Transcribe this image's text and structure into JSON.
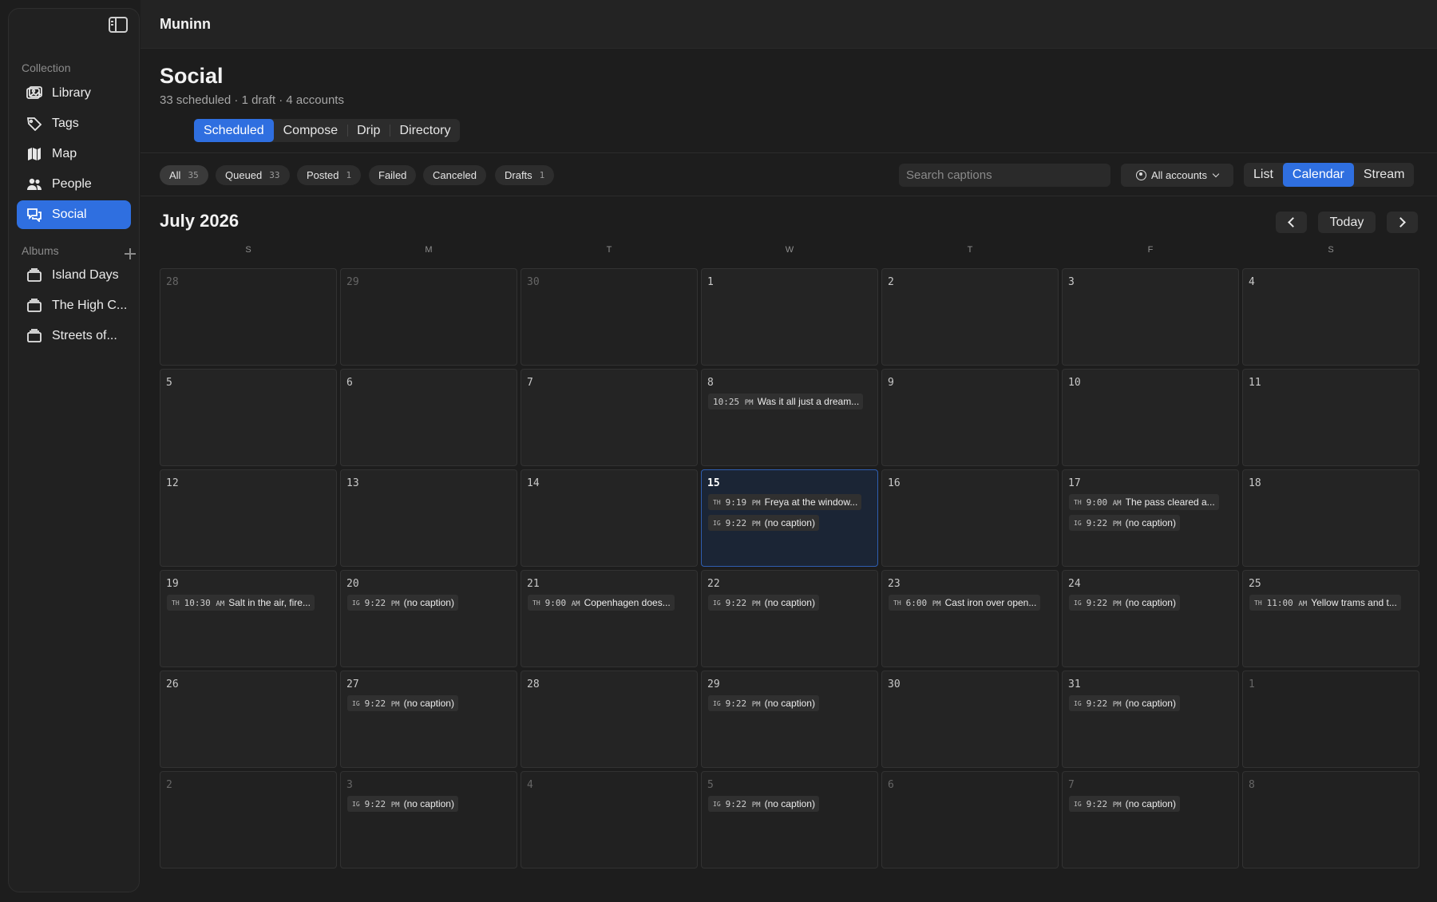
{
  "app": {
    "title": "Muninn"
  },
  "sidebar": {
    "collection_label": "Collection",
    "items": [
      {
        "label": "Library",
        "icon": "library-icon"
      },
      {
        "label": "Tags",
        "icon": "tag-icon"
      },
      {
        "label": "Map",
        "icon": "map-icon"
      },
      {
        "label": "People",
        "icon": "people-icon"
      },
      {
        "label": "Social",
        "icon": "social-icon",
        "active": true
      }
    ],
    "albums_label": "Albums",
    "albums": [
      {
        "label": "Island Days"
      },
      {
        "label": "The High C..."
      },
      {
        "label": "Streets of..."
      }
    ]
  },
  "page": {
    "title": "Social",
    "subtitle": "33 scheduled · 1 draft · 4 accounts",
    "tabs": [
      {
        "label": "Scheduled",
        "active": true
      },
      {
        "label": "Compose"
      },
      {
        "label": "Drip"
      },
      {
        "label": "Directory"
      }
    ]
  },
  "filters": [
    {
      "label": "All",
      "count": "35",
      "active": true
    },
    {
      "label": "Queued",
      "count": "33"
    },
    {
      "label": "Posted",
      "count": "1"
    },
    {
      "label": "Failed",
      "count": ""
    },
    {
      "label": "Canceled",
      "count": ""
    },
    {
      "label": "Drafts",
      "count": "1"
    }
  ],
  "search": {
    "placeholder": "Search captions"
  },
  "accounts": {
    "label": "All accounts"
  },
  "view_modes": [
    {
      "label": "List"
    },
    {
      "label": "Calendar",
      "active": true
    },
    {
      "label": "Stream"
    }
  ],
  "calendar": {
    "month_label": "July 2026",
    "today_label": "Today",
    "weekdays": [
      "S",
      "M",
      "T",
      "W",
      "T",
      "F",
      "S"
    ],
    "weeks": [
      [
        {
          "day": "28",
          "outside": true,
          "events": []
        },
        {
          "day": "29",
          "outside": true,
          "events": []
        },
        {
          "day": "30",
          "outside": true,
          "events": []
        },
        {
          "day": "1",
          "events": []
        },
        {
          "day": "2",
          "events": []
        },
        {
          "day": "3",
          "events": []
        },
        {
          "day": "4",
          "events": []
        }
      ],
      [
        {
          "day": "5",
          "events": []
        },
        {
          "day": "6",
          "events": []
        },
        {
          "day": "7",
          "events": []
        },
        {
          "day": "8",
          "events": [
            {
              "tag": "",
              "time": "10:25",
              "ampm": "PM",
              "caption": "Was it all just a dream..."
            }
          ]
        },
        {
          "day": "9",
          "events": []
        },
        {
          "day": "10",
          "events": []
        },
        {
          "day": "11",
          "events": []
        }
      ],
      [
        {
          "day": "12",
          "events": []
        },
        {
          "day": "13",
          "events": []
        },
        {
          "day": "14",
          "events": []
        },
        {
          "day": "15",
          "today": true,
          "events": [
            {
              "tag": "TH",
              "time": "9:19",
              "ampm": "PM",
              "caption": "Freya at the window..."
            },
            {
              "tag": "IG",
              "time": "9:22",
              "ampm": "PM",
              "caption": "(no caption)"
            }
          ]
        },
        {
          "day": "16",
          "events": []
        },
        {
          "day": "17",
          "events": [
            {
              "tag": "TH",
              "time": "9:00",
              "ampm": "AM",
              "caption": "The pass cleared a..."
            },
            {
              "tag": "IG",
              "time": "9:22",
              "ampm": "PM",
              "caption": "(no caption)"
            }
          ]
        },
        {
          "day": "18",
          "events": []
        }
      ],
      [
        {
          "day": "19",
          "events": [
            {
              "tag": "TH",
              "time": "10:30",
              "ampm": "AM",
              "caption": "Salt in the air, fire..."
            }
          ]
        },
        {
          "day": "20",
          "events": [
            {
              "tag": "IG",
              "time": "9:22",
              "ampm": "PM",
              "caption": "(no caption)"
            }
          ]
        },
        {
          "day": "21",
          "events": [
            {
              "tag": "TH",
              "time": "9:00",
              "ampm": "AM",
              "caption": "Copenhagen does..."
            }
          ]
        },
        {
          "day": "22",
          "events": [
            {
              "tag": "IG",
              "time": "9:22",
              "ampm": "PM",
              "caption": "(no caption)"
            }
          ]
        },
        {
          "day": "23",
          "events": [
            {
              "tag": "TH",
              "time": "6:00",
              "ampm": "PM",
              "caption": "Cast iron over open..."
            }
          ]
        },
        {
          "day": "24",
          "events": [
            {
              "tag": "IG",
              "time": "9:22",
              "ampm": "PM",
              "caption": "(no caption)"
            }
          ]
        },
        {
          "day": "25",
          "events": [
            {
              "tag": "TH",
              "time": "11:00",
              "ampm": "AM",
              "caption": "Yellow trams and t..."
            }
          ]
        }
      ],
      [
        {
          "day": "26",
          "events": []
        },
        {
          "day": "27",
          "events": [
            {
              "tag": "IG",
              "time": "9:22",
              "ampm": "PM",
              "caption": "(no caption)"
            }
          ]
        },
        {
          "day": "28",
          "events": []
        },
        {
          "day": "29",
          "events": [
            {
              "tag": "IG",
              "time": "9:22",
              "ampm": "PM",
              "caption": "(no caption)"
            }
          ]
        },
        {
          "day": "30",
          "events": []
        },
        {
          "day": "31",
          "events": [
            {
              "tag": "IG",
              "time": "9:22",
              "ampm": "PM",
              "caption": "(no caption)"
            }
          ]
        },
        {
          "day": "1",
          "outside": true,
          "events": []
        }
      ],
      [
        {
          "day": "2",
          "outside": true,
          "events": []
        },
        {
          "day": "3",
          "outside": true,
          "events": [
            {
              "tag": "IG",
              "time": "9:22",
              "ampm": "PM",
              "caption": "(no caption)"
            }
          ]
        },
        {
          "day": "4",
          "outside": true,
          "events": []
        },
        {
          "day": "5",
          "outside": true,
          "events": [
            {
              "tag": "IG",
              "time": "9:22",
              "ampm": "PM",
              "caption": "(no caption)"
            }
          ]
        },
        {
          "day": "6",
          "outside": true,
          "events": []
        },
        {
          "day": "7",
          "outside": true,
          "events": [
            {
              "tag": "IG",
              "time": "9:22",
              "ampm": "PM",
              "caption": "(no caption)"
            }
          ]
        },
        {
          "day": "8",
          "outside": true,
          "events": []
        }
      ]
    ]
  },
  "colors": {
    "accent": "#2f6fe0",
    "background": "#1d1d1d",
    "today_cell": "#1b2535"
  }
}
